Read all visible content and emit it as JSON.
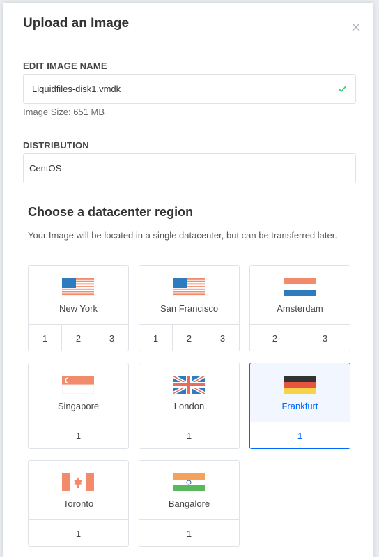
{
  "modal": {
    "title": "Upload an Image",
    "name_label": "EDIT IMAGE NAME",
    "name_value": "Liquidfiles-disk1.vmdk",
    "image_size": "Image Size: 651 MB",
    "distribution_label": "DISTRIBUTION",
    "distribution_value": "CentOS",
    "region_heading": "Choose a datacenter region",
    "region_desc": "Your Image will be located in a single datacenter, but can be transferred later."
  },
  "regions": [
    {
      "name": "New York",
      "flag": "us-flag",
      "numbers": [
        "1",
        "2",
        "3"
      ],
      "selected": false
    },
    {
      "name": "San Francisco",
      "flag": "us-flag",
      "numbers": [
        "1",
        "2",
        "3"
      ],
      "selected": false
    },
    {
      "name": "Amsterdam",
      "flag": "nl-flag",
      "numbers": [
        "2",
        "3"
      ],
      "selected": false
    },
    {
      "name": "Singapore",
      "flag": "sg-flag",
      "numbers": [
        "1"
      ],
      "selected": false
    },
    {
      "name": "London",
      "flag": "uk-flag",
      "numbers": [
        "1"
      ],
      "selected": false
    },
    {
      "name": "Frankfurt",
      "flag": "de-flag",
      "numbers": [
        "1"
      ],
      "selected": true
    },
    {
      "name": "Toronto",
      "flag": "ca-flag",
      "numbers": [
        "1"
      ],
      "selected": false
    },
    {
      "name": "Bangalore",
      "flag": "in-flag",
      "numbers": [
        "1"
      ],
      "selected": false
    }
  ],
  "colors": {
    "accent": "#0069ff",
    "valid": "#2ecc71"
  }
}
